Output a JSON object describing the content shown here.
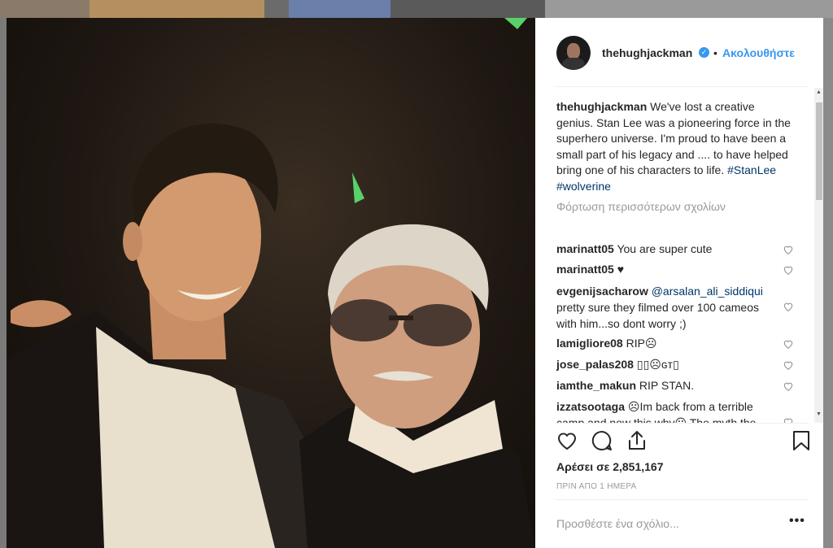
{
  "post": {
    "username": "thehughjackman",
    "follow_label": "Ακολουθήστε",
    "separator": "•",
    "verified_mark": "✓",
    "caption_user": "thehughjackman",
    "caption_text": " We've lost a creative genius. Stan Lee was a pioneering force in the superhero universe. I'm proud to have been a small part of his legacy and .... to have helped bring one of his characters to life. ",
    "tag1": "#StanLee",
    "tag2": "#wolverine",
    "load_more": "Φόρτωση περισσότερων σχολίων",
    "likes": "Αρέσει σε 2,851,167",
    "time": "ΠΡΙΝ ΑΠΟ 1 ΗΜΕΡΑ",
    "add_comment_placeholder": "Προσθέστε ένα σχόλιο...",
    "more_label": "•••"
  },
  "comments": [
    {
      "user": "marinatt05",
      "text": " You are super cute"
    },
    {
      "user": "marinatt05",
      "text": " ♥"
    },
    {
      "user": "evgenijsacharow",
      "mention": " @arsalan_ali_siddiqui",
      "text": " pretty sure they filmed over 100 cameos with him...so dont worry ;)"
    },
    {
      "user": "lamigliore08",
      "text": " RIP☹"
    },
    {
      "user": "jose_palas208",
      "text": " ▯▯☹ɢᴛ▯"
    },
    {
      "user": "iamthe_makun",
      "text": " RIP STAN."
    },
    {
      "user": "izzatsootaga",
      "text": " ☹Im back from a terrible camp and now this why☹ The myth the legend Stan Lee"
    }
  ],
  "colors": {
    "accent": "#3897f0",
    "text": "#262626",
    "muted": "#999999"
  },
  "icons": [
    "heart-icon",
    "comment-icon",
    "share-icon",
    "bookmark-icon",
    "verified-icon"
  ]
}
